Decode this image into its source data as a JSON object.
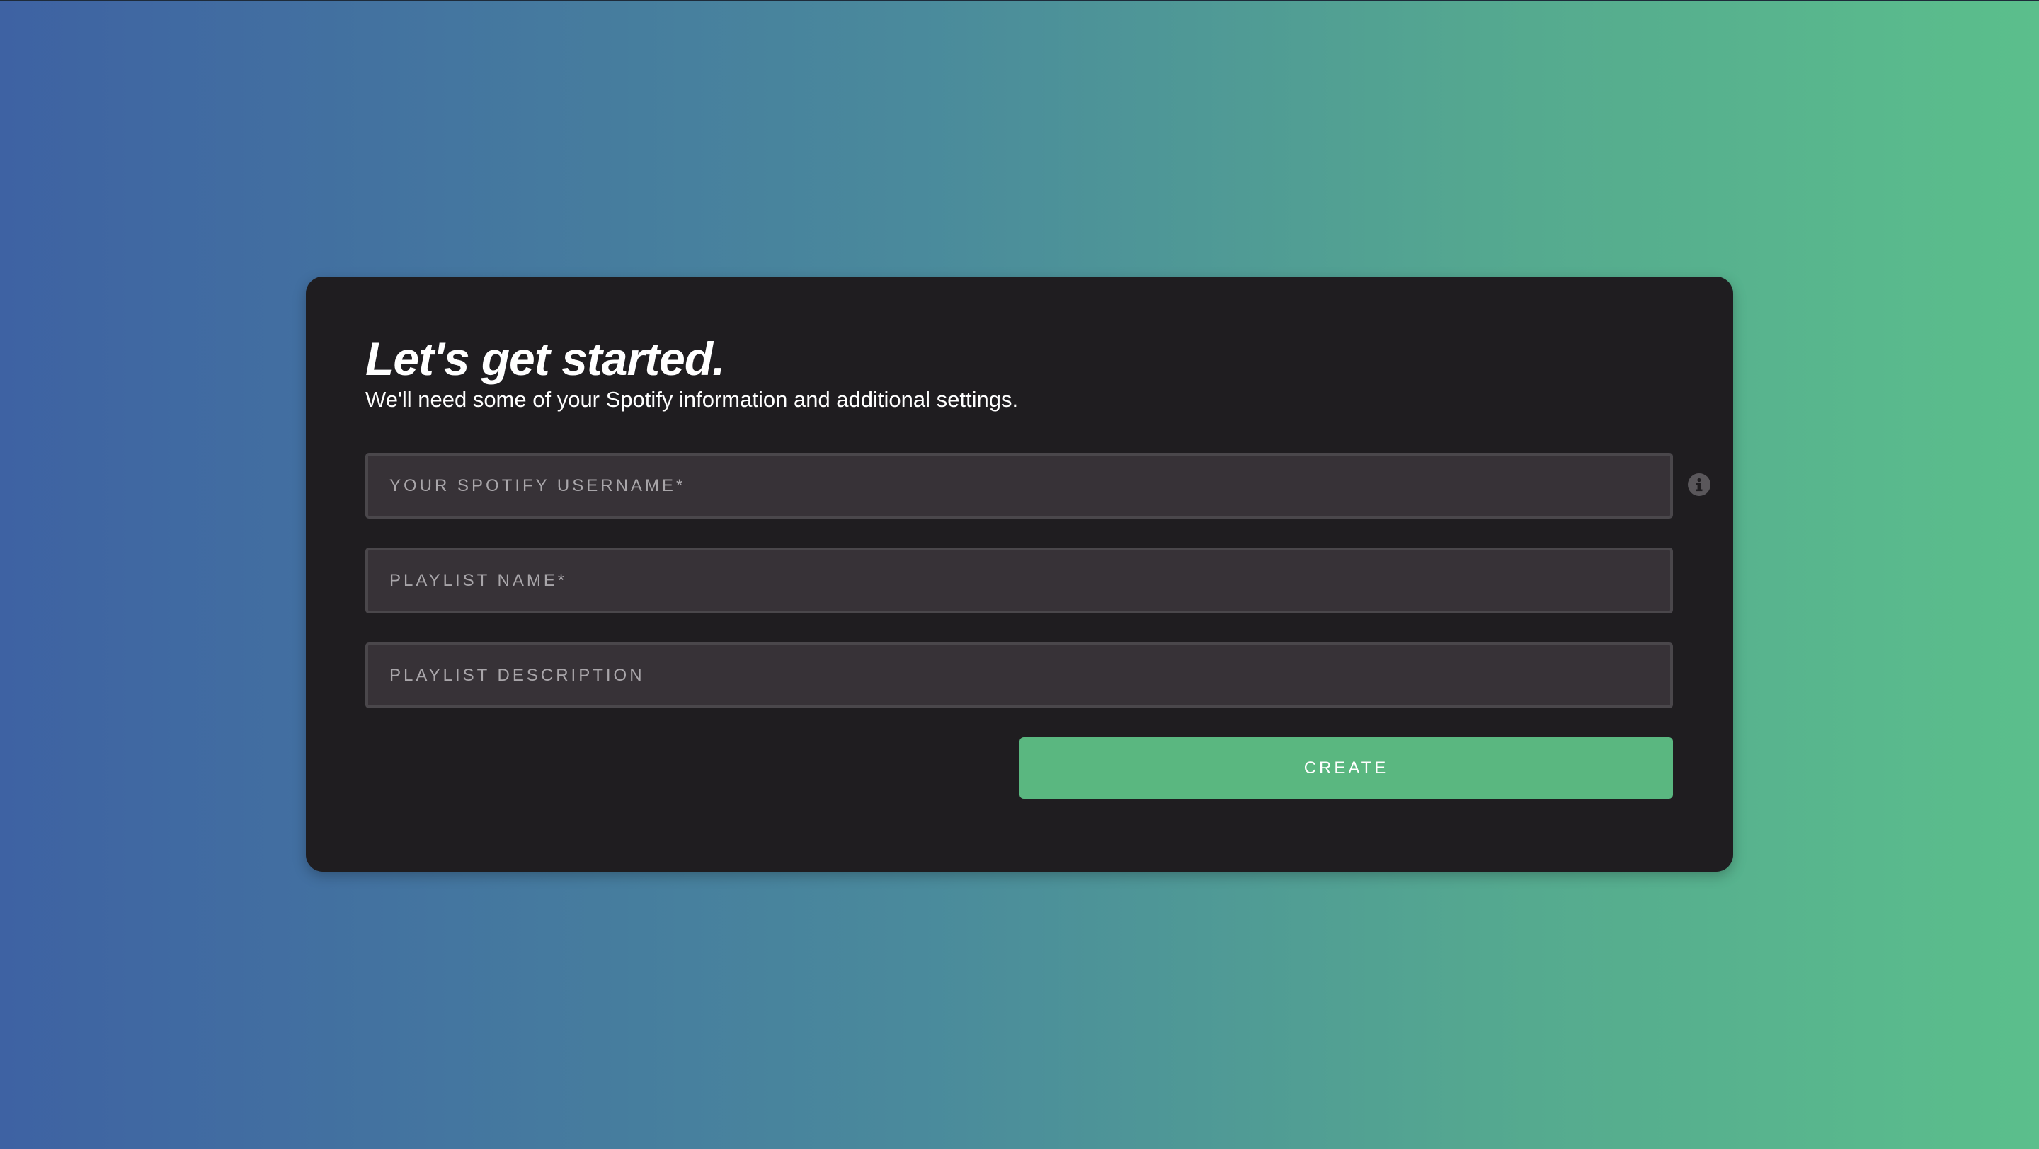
{
  "background": {
    "gradient_start": "#3e62a3",
    "gradient_end": "#5bbf8c"
  },
  "card": {
    "title": "Let's get started.",
    "subtitle": "We'll need some of your Spotify information and additional settings.",
    "fields": {
      "username": {
        "placeholder": "YOUR SPOTIFY USERNAME*",
        "value": ""
      },
      "playlist_name": {
        "placeholder": "PLAYLIST NAME*",
        "value": ""
      },
      "playlist_description": {
        "placeholder": "PLAYLIST DESCRIPTION",
        "value": ""
      }
    },
    "info_icon": "info-icon",
    "create_label": "CREATE",
    "accent_color": "#5ab780",
    "card_color": "#1f1d20"
  }
}
